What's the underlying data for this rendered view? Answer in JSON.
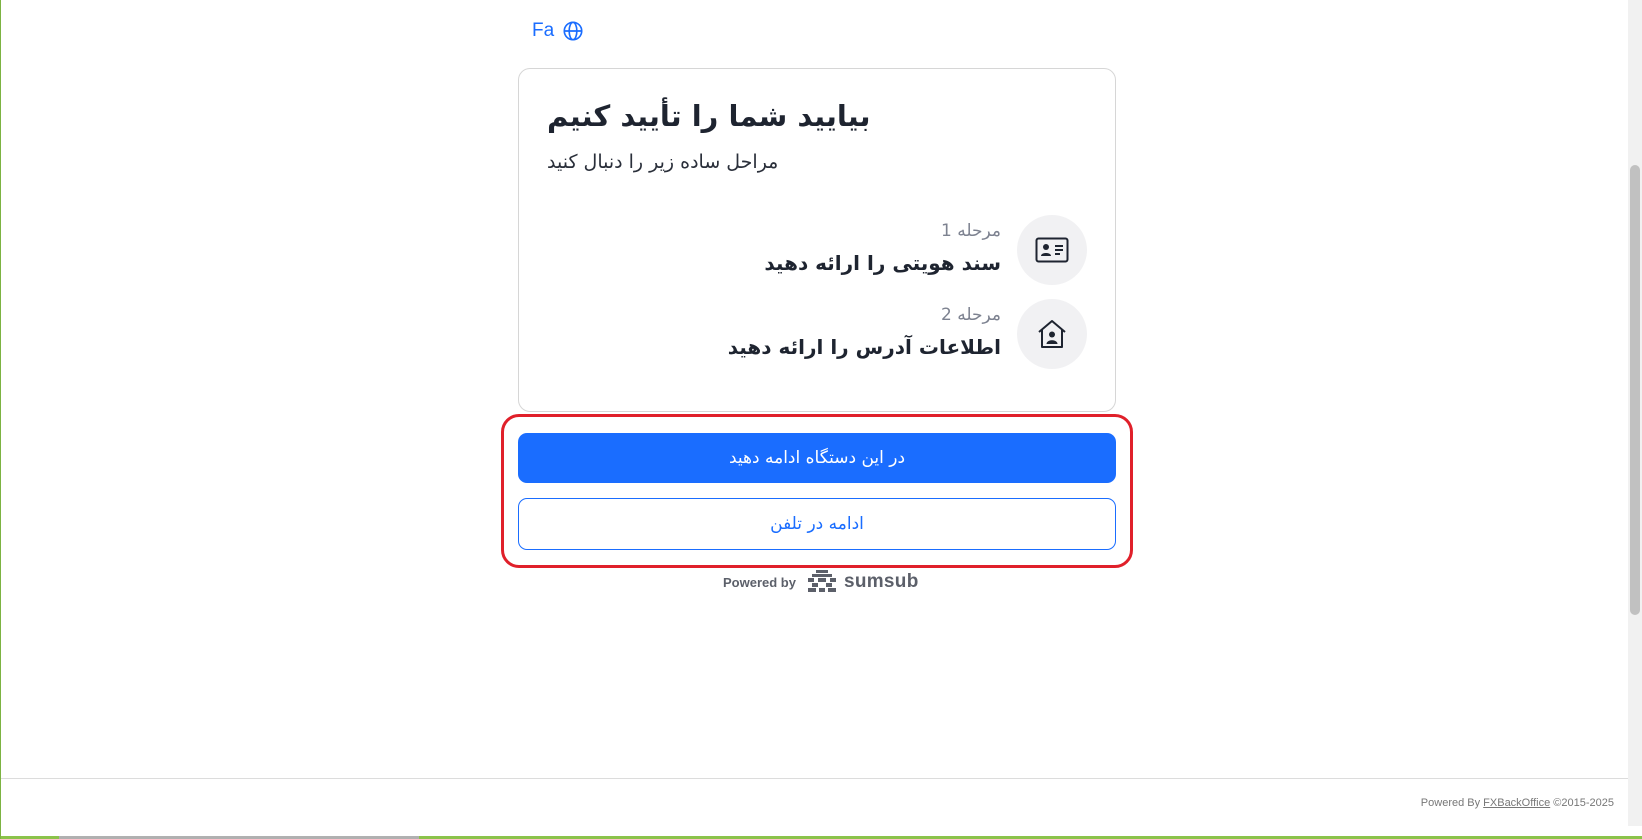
{
  "language": {
    "label": "Fa",
    "icon": "globe-icon"
  },
  "card": {
    "title": "بیایید شما را تأیید کنیم",
    "subtitle": "مراحل ساده زیر را دنبال کنید",
    "steps": [
      {
        "number": "مرحله 1",
        "text": "سند هویتی را ارائه دهید",
        "icon": "id-card-icon"
      },
      {
        "number": "مرحله 2",
        "text": "اطلاعات آدرس را ارائه دهید",
        "icon": "home-address-icon"
      }
    ]
  },
  "actions": {
    "primary_label": "در این دستگاه ادامه دهید",
    "secondary_label": "ادامه در تلفن"
  },
  "powered_by": {
    "label": "Powered by",
    "brand": "sumsub"
  },
  "footer": {
    "prefix": "Powered By",
    "link": "FXBackOffice",
    "suffix": "©2015-2025"
  },
  "colors": {
    "accent": "#1a6dff",
    "highlight": "#e0202a",
    "title": "#1e2430"
  }
}
